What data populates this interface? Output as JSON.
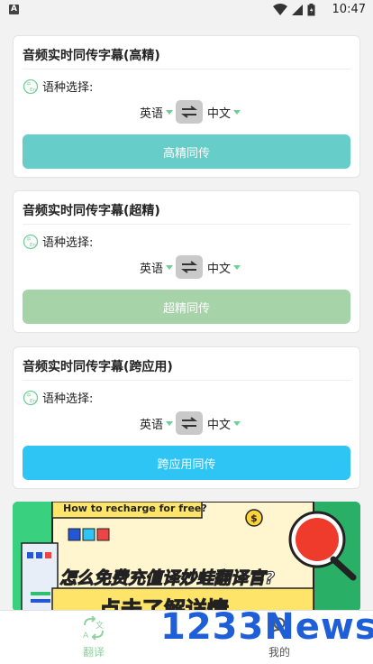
{
  "status_bar": {
    "time": "10:47",
    "app_indicator": "A"
  },
  "cards": [
    {
      "title": "音频实时同传字幕(高精)",
      "lang_label": "语种选择:",
      "from_lang": "英语",
      "to_lang": "中文",
      "action_label": "高精同传",
      "button_color": "#66cdc8"
    },
    {
      "title": "音频实时同传字幕(超精)",
      "lang_label": "语种选择:",
      "from_lang": "英语",
      "to_lang": "中文",
      "action_label": "超精同传",
      "button_color": "#a6d3a8"
    },
    {
      "title": "音频实时同传字幕(跨应用)",
      "lang_label": "语种选择:",
      "from_lang": "英语",
      "to_lang": "中文",
      "action_label": "跨应用同传",
      "button_color": "#2ec4f4"
    }
  ],
  "banner": {
    "top_text": "How to recharge for free?",
    "headline_pre": "怎么",
    "headline_hl": "免费",
    "headline_post": "充值译妙蛙翻译官?",
    "cta": "点击了解详情"
  },
  "bottom_nav": {
    "items": [
      {
        "label": "翻译",
        "active": true
      },
      {
        "label": "我的",
        "active": false
      }
    ]
  },
  "watermark": "1233News",
  "colors": {
    "accent_green": "#6fcf97",
    "nav_active": "#8fd3a0",
    "nav_inactive": "#555555"
  }
}
